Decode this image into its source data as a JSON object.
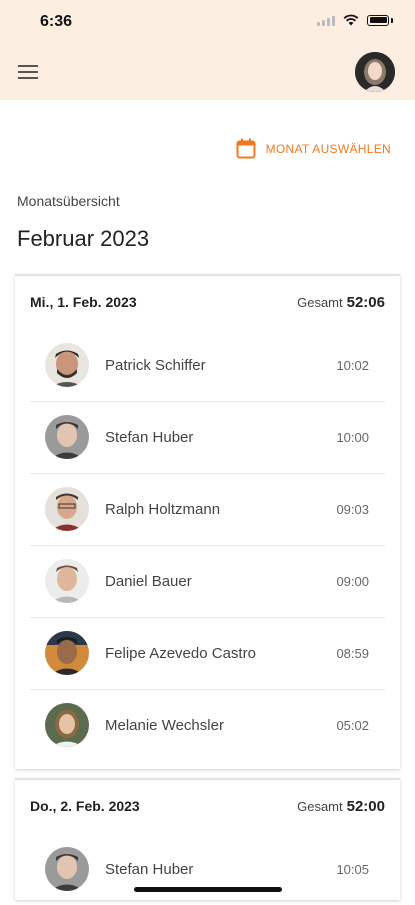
{
  "status": {
    "time": "6:36"
  },
  "header": {
    "menu_icon": "menu-icon",
    "avatar_icon": "profile-avatar"
  },
  "action": {
    "month_select_label": "MONAT AUSWÄHLEN",
    "icon": "calendar-icon",
    "accent": "#f0781e"
  },
  "overview": {
    "label": "Monatsübersicht",
    "month": "Februar 2023"
  },
  "days": [
    {
      "date": "Mi., 1. Feb. 2023",
      "total_label": "Gesamt",
      "total": "52:06",
      "entries": [
        {
          "name": "Patrick Schiffer",
          "duration": "10:02"
        },
        {
          "name": "Stefan Huber",
          "duration": "10:00"
        },
        {
          "name": "Ralph Holtzmann",
          "duration": "09:03"
        },
        {
          "name": "Daniel Bauer",
          "duration": "09:00"
        },
        {
          "name": "Felipe Azevedo  Castro",
          "duration": "08:59"
        },
        {
          "name": "Melanie Wechsler",
          "duration": "05:02"
        }
      ]
    },
    {
      "date": "Do., 2. Feb. 2023",
      "total_label": "Gesamt",
      "total": "52:00",
      "entries": [
        {
          "name": "Stefan Huber",
          "duration": "10:05"
        }
      ]
    }
  ]
}
